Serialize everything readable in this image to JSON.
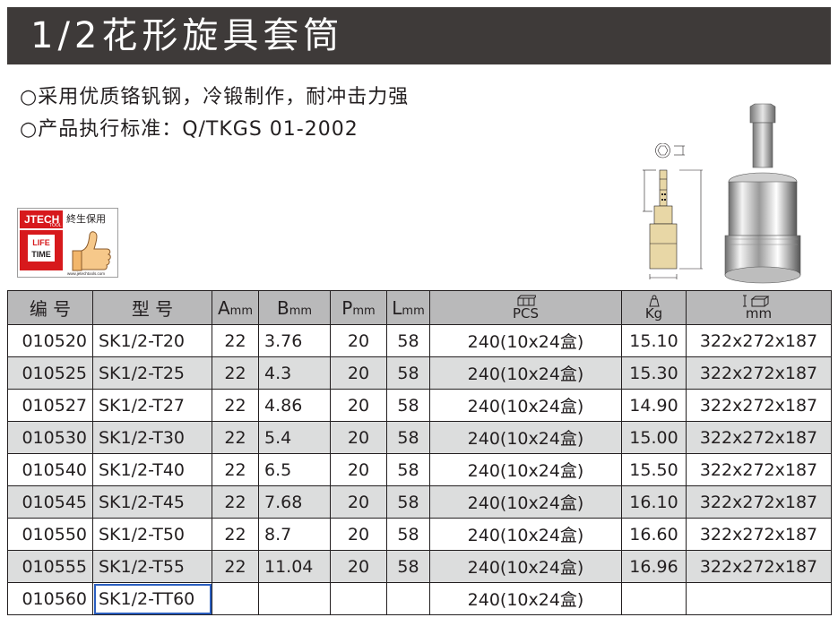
{
  "title": "1/2花形旋具套筒",
  "specs": {
    "line1": "○采用优质铬钒钢，冷锻制作，耐冲击力强",
    "line2": "○产品执行标准：Q/TKGS 01-2002"
  },
  "logo": {
    "brand": "JTECH",
    "brand_sub": "TOOL",
    "warranty": "終生保用",
    "badge_line1": "LIFE",
    "badge_line2": "TIME",
    "website": "www.jetechtools.com",
    "icon": "thumbs-up-icon"
  },
  "table": {
    "headers": {
      "code": "编 号",
      "model": "型 号",
      "a_sym": "A",
      "b_sym": "B",
      "p_sym": "P",
      "l_sym": "L",
      "unit_mm": "mm",
      "pcs": "PCS",
      "kg": "Kg",
      "size_unit": "mm"
    },
    "rows": [
      {
        "code": "010520",
        "model": "SK1/2-T20",
        "a": "22",
        "b": "3.76",
        "p": "20",
        "l": "58",
        "pcs": "240(10x24盒)",
        "kg": "15.10",
        "size": "322x272x187"
      },
      {
        "code": "010525",
        "model": "SK1/2-T25",
        "a": "22",
        "b": "4.3",
        "p": "20",
        "l": "58",
        "pcs": "240(10x24盒)",
        "kg": "15.30",
        "size": "322x272x187"
      },
      {
        "code": "010527",
        "model": "SK1/2-T27",
        "a": "22",
        "b": "4.86",
        "p": "20",
        "l": "58",
        "pcs": "240(10x24盒)",
        "kg": "14.90",
        "size": "322x272x187"
      },
      {
        "code": "010530",
        "model": "SK1/2-T30",
        "a": "22",
        "b": "5.4",
        "p": "20",
        "l": "58",
        "pcs": "240(10x24盒)",
        "kg": "15.00",
        "size": "322x272x187"
      },
      {
        "code": "010540",
        "model": "SK1/2-T40",
        "a": "22",
        "b": "6.5",
        "p": "20",
        "l": "58",
        "pcs": "240(10x24盒)",
        "kg": "15.50",
        "size": "322x272x187"
      },
      {
        "code": "010545",
        "model": "SK1/2-T45",
        "a": "22",
        "b": "7.68",
        "p": "20",
        "l": "58",
        "pcs": "240(10x24盒)",
        "kg": "16.10",
        "size": "322x272x187"
      },
      {
        "code": "010550",
        "model": "SK1/2-T50",
        "a": "22",
        "b": "8.7",
        "p": "20",
        "l": "58",
        "pcs": "240(10x24盒)",
        "kg": "16.60",
        "size": "322x272x187"
      },
      {
        "code": "010555",
        "model": "SK1/2-T55",
        "a": "22",
        "b": "11.04",
        "p": "20",
        "l": "58",
        "pcs": "240(10x24盒)",
        "kg": "16.96",
        "size": "322x272x187"
      },
      {
        "code": "010560",
        "model": "SK1/2-TT60",
        "a": "",
        "b": "",
        "p": "",
        "l": "",
        "pcs": "240(10x24盒)",
        "kg": "",
        "size": ""
      }
    ]
  },
  "colors": {
    "title_bar": "#3e3a39",
    "header_fill": "#b9b9ba",
    "row_shade": "#dcdddd",
    "logo_red": "#d7191c",
    "selection": "#2b5fc0"
  }
}
